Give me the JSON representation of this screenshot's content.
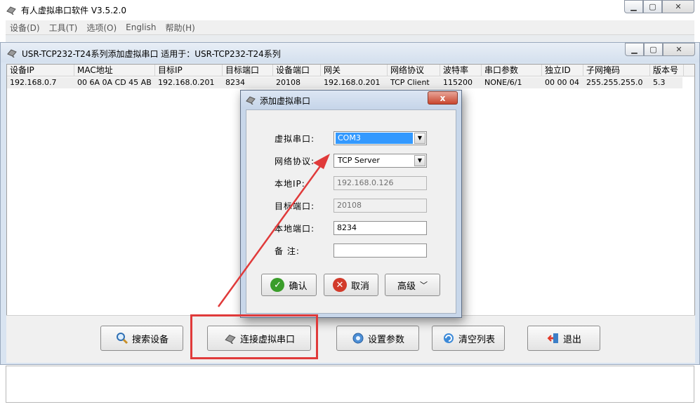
{
  "main_window": {
    "title": "有人虚拟串口软件 V3.5.2.0",
    "menu": [
      "设备(D)",
      "工具(T)",
      "选项(O)",
      "English",
      "帮助(H)"
    ]
  },
  "sub_window": {
    "title": "USR-TCP232-T24系列添加虚拟串口  适用于：USR-TCP232-T24系列",
    "columns": [
      "设备IP",
      "MAC地址",
      "目标IP",
      "目标端口",
      "设备端口",
      "网关",
      "网络协议",
      "波特率",
      "串口参数",
      "独立ID",
      "子网掩码",
      "版本号"
    ],
    "rows": [
      [
        "192.168.0.7",
        "00 6A 0A CD 45 AB",
        "192.168.0.201",
        "8234",
        "20108",
        "192.168.0.201",
        "TCP Client",
        "115200",
        "NONE/6/1",
        "00 00 04",
        "255.255.255.0",
        "5.3"
      ]
    ],
    "buttons": {
      "search": "搜索设备",
      "connect": "连接虚拟串口",
      "settings": "设置参数",
      "clear": "清空列表",
      "exit": "退出"
    }
  },
  "dialog": {
    "title": "添加虚拟串口",
    "close_label": "x",
    "labels": {
      "virtual_port": "虚拟串口:",
      "protocol": "网络协议:",
      "local_ip": "本地IP:",
      "target_port": "目标端口:",
      "local_port": "本地端口:",
      "remark": "备  注:"
    },
    "values": {
      "virtual_port": "COM3",
      "protocol": "TCP Server",
      "local_ip": "192.168.0.126",
      "target_port": "20108",
      "local_port": "8234",
      "remark": ""
    },
    "buttons": {
      "ok": "确认",
      "cancel": "取消",
      "advanced": "高级"
    }
  },
  "colors": {
    "annotation_red": "#e03a3a",
    "selection_blue": "#3399ff"
  }
}
